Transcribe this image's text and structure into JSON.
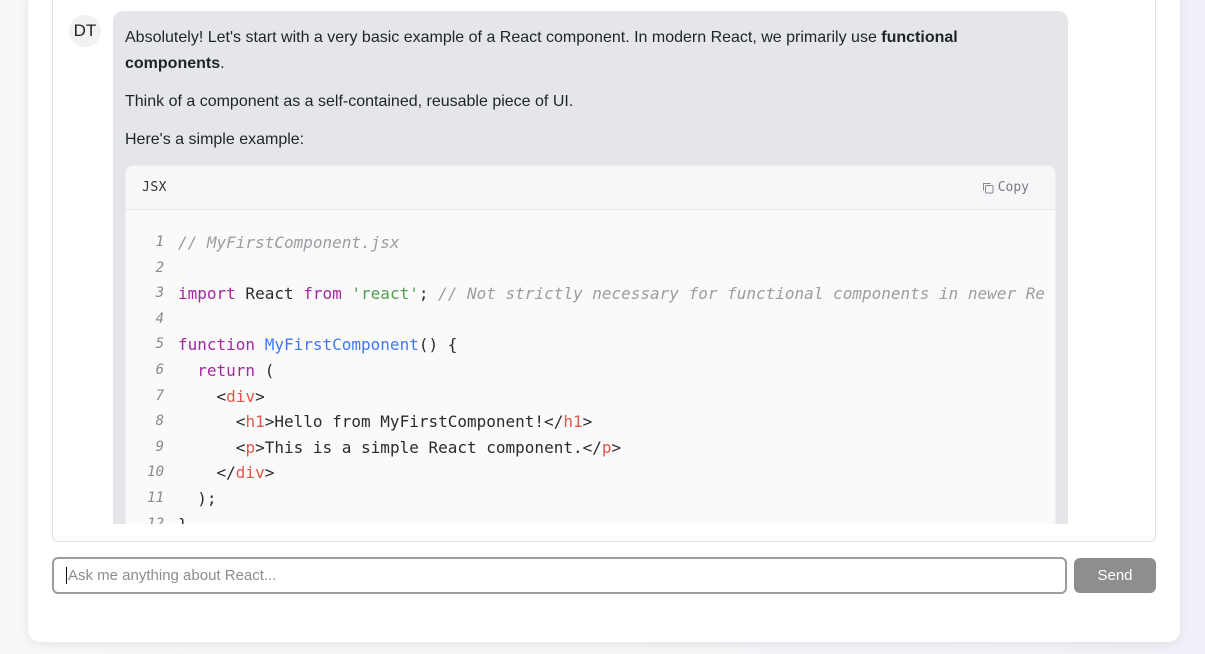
{
  "message": {
    "avatar_initials": "DT",
    "para1_pre": "Absolutely! Let's start with a very basic example of a React component. In modern React, we primarily use ",
    "para1_bold": "functional components",
    "para1_post": ".",
    "para2": "Think of a component as a self-contained, reusable piece of UI.",
    "para3": "Here's a simple example:"
  },
  "code_block": {
    "language": "JSX",
    "copy_label": "Copy",
    "icon": "copy-icon",
    "lines": [
      {
        "n": "1",
        "tokens": [
          [
            "cm",
            "// MyFirstComponent.jsx"
          ]
        ]
      },
      {
        "n": "2",
        "tokens": []
      },
      {
        "n": "3",
        "tokens": [
          [
            "kw",
            "import"
          ],
          [
            "plain",
            " React "
          ],
          [
            "kw",
            "from"
          ],
          [
            "plain",
            " "
          ],
          [
            "str",
            "'react'"
          ],
          [
            "plain",
            "; "
          ],
          [
            "cm",
            "// Not strictly necessary for functional components in newer Re"
          ]
        ]
      },
      {
        "n": "4",
        "tokens": []
      },
      {
        "n": "5",
        "tokens": [
          [
            "kw",
            "function"
          ],
          [
            "plain",
            " "
          ],
          [
            "fn",
            "MyFirstComponent"
          ],
          [
            "plain",
            "() {"
          ]
        ]
      },
      {
        "n": "6",
        "tokens": [
          [
            "plain",
            "  "
          ],
          [
            "kw",
            "return"
          ],
          [
            "plain",
            " ("
          ]
        ]
      },
      {
        "n": "7",
        "tokens": [
          [
            "plain",
            "    <"
          ],
          [
            "tag",
            "div"
          ],
          [
            "plain",
            ">"
          ]
        ]
      },
      {
        "n": "8",
        "tokens": [
          [
            "plain",
            "      <"
          ],
          [
            "tag",
            "h1"
          ],
          [
            "plain",
            ">Hello from MyFirstComponent!</"
          ],
          [
            "tag",
            "h1"
          ],
          [
            "plain",
            ">"
          ]
        ]
      },
      {
        "n": "9",
        "tokens": [
          [
            "plain",
            "      <"
          ],
          [
            "tag",
            "p"
          ],
          [
            "plain",
            ">This is a simple React component.</"
          ],
          [
            "tag",
            "p"
          ],
          [
            "plain",
            ">"
          ]
        ]
      },
      {
        "n": "10",
        "tokens": [
          [
            "plain",
            "    </"
          ],
          [
            "tag",
            "div"
          ],
          [
            "plain",
            ">"
          ]
        ]
      },
      {
        "n": "11",
        "tokens": [
          [
            "plain",
            "  );"
          ]
        ]
      },
      {
        "n": "12",
        "tokens": [
          [
            "plain",
            "}"
          ]
        ]
      }
    ]
  },
  "composer": {
    "placeholder": "Ask me anything about React...",
    "value": "",
    "send_label": "Send"
  },
  "colors": {
    "bubble": "#e5e6ea",
    "send_button": "#8e8e90",
    "keyword": "#a626a4",
    "string": "#50a14f",
    "function": "#4078f2",
    "tag": "#e45649",
    "comment": "#9c9ca2"
  }
}
